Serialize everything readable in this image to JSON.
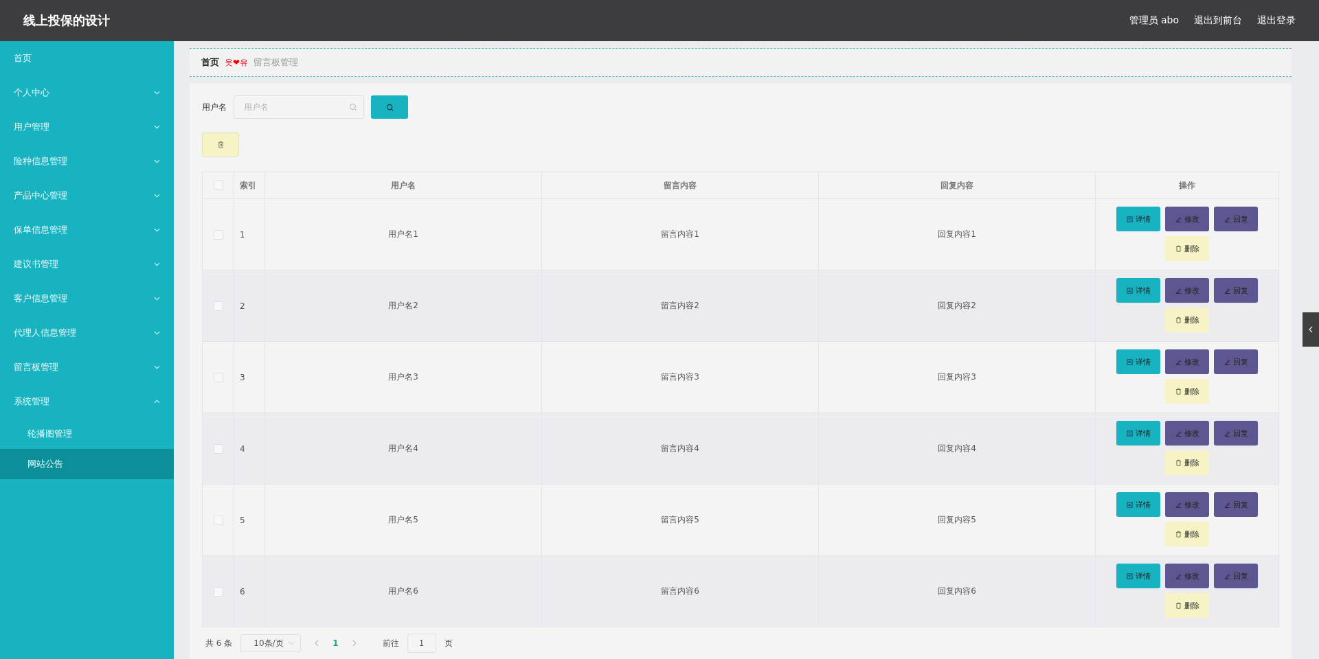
{
  "header": {
    "title": "线上投保的设计",
    "user": "管理员 abo",
    "links": [
      "退出到前台",
      "退出登录"
    ]
  },
  "sidebar": {
    "items": [
      {
        "label": "首页",
        "kind": "link"
      },
      {
        "label": "个人中心",
        "kind": "group",
        "expanded": false
      },
      {
        "label": "用户管理",
        "kind": "group",
        "expanded": false
      },
      {
        "label": "险种信息管理",
        "kind": "group",
        "expanded": false
      },
      {
        "label": "产品中心管理",
        "kind": "group",
        "expanded": false
      },
      {
        "label": "保单信息管理",
        "kind": "group",
        "expanded": false
      },
      {
        "label": "建议书管理",
        "kind": "group",
        "expanded": false
      },
      {
        "label": "客户信息管理",
        "kind": "group",
        "expanded": false
      },
      {
        "label": "代理人信息管理",
        "kind": "group",
        "expanded": false
      },
      {
        "label": "留言板管理",
        "kind": "group",
        "expanded": false
      },
      {
        "label": "系统管理",
        "kind": "group",
        "expanded": true,
        "children": [
          {
            "label": "轮播图管理",
            "selected": false
          },
          {
            "label": "网站公告",
            "selected": true
          }
        ]
      }
    ]
  },
  "breadcrumb": {
    "home": "首页",
    "separator": "웃❤유",
    "current": "留言板管理"
  },
  "search": {
    "label": "用户名",
    "placeholder": "用户名"
  },
  "table": {
    "columns": [
      "索引",
      "用户名",
      "留言内容",
      "回复内容",
      "操作"
    ],
    "header_checked": false,
    "rows": [
      {
        "checked": false,
        "cells": [
          "1",
          "用户名1",
          "留言内容1",
          "回复内容1"
        ],
        "actions": [
          {
            "kind": "detail",
            "label": "详情"
          },
          {
            "kind": "edit",
            "label": "修改"
          },
          {
            "kind": "reply",
            "label": "回复"
          },
          {
            "kind": "delete",
            "label": "删除"
          }
        ]
      },
      {
        "checked": false,
        "cells": [
          "2",
          "用户名2",
          "留言内容2",
          "回复内容2"
        ],
        "actions": [
          {
            "kind": "detail",
            "label": "详情"
          },
          {
            "kind": "edit",
            "label": "修改"
          },
          {
            "kind": "reply",
            "label": "回复"
          },
          {
            "kind": "delete",
            "label": "删除"
          }
        ]
      },
      {
        "checked": false,
        "cells": [
          "3",
          "用户名3",
          "留言内容3",
          "回复内容3"
        ],
        "actions": [
          {
            "kind": "detail",
            "label": "详情"
          },
          {
            "kind": "edit",
            "label": "修改"
          },
          {
            "kind": "reply",
            "label": "回复"
          },
          {
            "kind": "delete",
            "label": "删除"
          }
        ]
      },
      {
        "checked": false,
        "cells": [
          "4",
          "用户名4",
          "留言内容4",
          "回复内容4"
        ],
        "actions": [
          {
            "kind": "detail",
            "label": "详情"
          },
          {
            "kind": "edit",
            "label": "修改"
          },
          {
            "kind": "reply",
            "label": "回复"
          },
          {
            "kind": "delete",
            "label": "删除"
          }
        ]
      },
      {
        "checked": false,
        "cells": [
          "5",
          "用户名5",
          "留言内容5",
          "回复内容5"
        ],
        "actions": [
          {
            "kind": "detail",
            "label": "详情"
          },
          {
            "kind": "edit",
            "label": "修改"
          },
          {
            "kind": "reply",
            "label": "回复"
          },
          {
            "kind": "delete",
            "label": "删除"
          }
        ]
      },
      {
        "checked": false,
        "cells": [
          "6",
          "用户名6",
          "留言内容6",
          "回复内容6"
        ],
        "actions": [
          {
            "kind": "detail",
            "label": "详情"
          },
          {
            "kind": "edit",
            "label": "修改"
          },
          {
            "kind": "reply",
            "label": "回复"
          },
          {
            "kind": "delete",
            "label": "删除"
          }
        ]
      }
    ]
  },
  "pagination": {
    "total": "共 6 条",
    "page_size": "10条/页",
    "pages": [
      {
        "label": "1",
        "selected": true
      }
    ],
    "goto_label": "前往",
    "goto_value": "1",
    "goto_suffix": "页"
  }
}
